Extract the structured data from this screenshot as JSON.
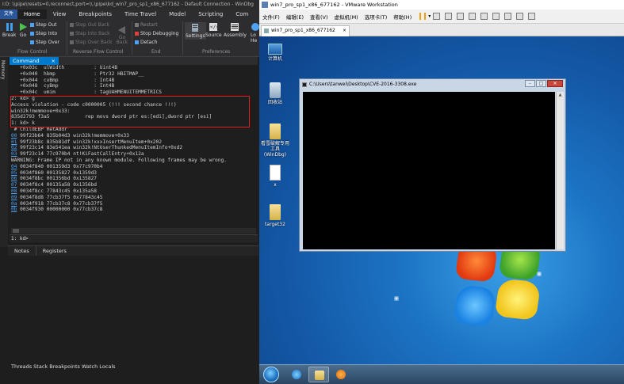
{
  "windbg": {
    "title": "I:D: \\\\pipe\\resets=0,reconnect,port=\\\\.\\pipe\\kd_win7_pro_sp1_x86_677162 - Default Connection - WinDbg",
    "file_tab": "文件",
    "menu_tabs": [
      "Home",
      "View",
      "Breakpoints",
      "Time Travel",
      "Model",
      "Scripting",
      "Com"
    ],
    "ribbon": {
      "break": "Break",
      "go": "Go",
      "step_out": "Step Out",
      "step_into": "Step Into",
      "step_over": "Step Over",
      "step_out_back": "Step Out Back",
      "step_into_back": "Step Into Back",
      "step_over_back": "Step Over Back",
      "go_back": "Go Back",
      "restart": "Restart",
      "stop_debugging": "Stop Debugging",
      "detach": "Detach",
      "settings": "Settings",
      "source": "Source",
      "assembly": "Assembly",
      "local_help": "Lo He",
      "groups": {
        "flow_control": "Flow Control",
        "reverse_flow_control": "Reverse Flow Control",
        "end": "End",
        "preferences": "Preferences"
      }
    },
    "side_labels": [
      "Memory"
    ],
    "command_tab": "Command",
    "command_output": [
      "   +0x03c  ulWidth          : Uint4B",
      "   +0x040  hbmp             : Ptr32 HBITMAP__",
      "   +0x044  cxBmp            : Int4B",
      "   +0x048  cyBmp            : Int4B",
      "   +0x04c  umim             : tagUAHMENUITEMMETRICS",
      "2: kd> g",
      "Access violation - code c0000005 (!!! second chance !!!)",
      "win32k!memmove+0x33:",
      "835d2793 f3a5            rep movs dword ptr es:[edi],dword ptr [esi]",
      "1: kd> k",
      " # ChildEBP RetAddr",
      "00 99f23b64 835b04d3 win32k!memmove+0x33",
      "01 99f23b8c 835b81df win32k!xxxInsertMenuItem+0x202",
      "02 99f23c14 83e541ea win32k!NtUserThunkedMenuItemInfo+0xd2",
      "03 99f23c14 77c970b4 nt!KiFastCallEntry+0x12a",
      "WARNING: Frame IP not in any known module. Following frames may be wrong.",
      "04 0034f840 001359d3 0x77c970b4",
      "05 0034f860 00135827 0x1359d3",
      "06 0034f8bc 001356bd 0x135827",
      "07 0034f8c4 00135a58 0x1356bd",
      "08 0034f8cc 77843c45 0x135a58",
      "09 0034f8d8 77cb37f5 0x77843c45",
      "0a 0034f918 77cb37c8 0x77cb37f5",
      "0b 0034f930 00000000 0x77cb37c8"
    ],
    "frame_links": [
      "00",
      "01",
      "02",
      "03",
      "04",
      "05",
      "06",
      "07",
      "08",
      "09",
      "0a",
      "0b"
    ],
    "prompt": "1: kd>",
    "bottom_tabs": [
      "Notes",
      "Registers"
    ],
    "bottom_footer": "Threads Stack Breakpoints Watch Locals"
  },
  "vmware": {
    "title": "win7_pro_sp1_x86_677162 - VMware Workstation",
    "menu": [
      "文件(F)",
      "编辑(E)",
      "查看(V)",
      "虚拟机(M)",
      "选项卡(T)",
      "帮助(H)"
    ],
    "vm_tab": "win7_pro_sp1_x86_677162",
    "desktop_icons": [
      {
        "label": "计算机",
        "kind": "computer"
      },
      {
        "label": "回收站",
        "kind": "bin"
      },
      {
        "label": "看雪破解专用工具(WinDbg)",
        "kind": "folder"
      },
      {
        "label": "x",
        "kind": "file"
      },
      {
        "label": "target32",
        "kind": "folder"
      }
    ],
    "console": {
      "title": "C:\\Users\\tanwei\\Desktop\\CVE-2016-3308.exe",
      "minimize": "–",
      "maximize": "□",
      "close": "✕"
    }
  },
  "colors": {
    "windbg_bg": "#1e1e1e",
    "accent_blue": "#007acc",
    "highlight_red": "#e02020",
    "desktop_blue": "#1c74c4"
  }
}
